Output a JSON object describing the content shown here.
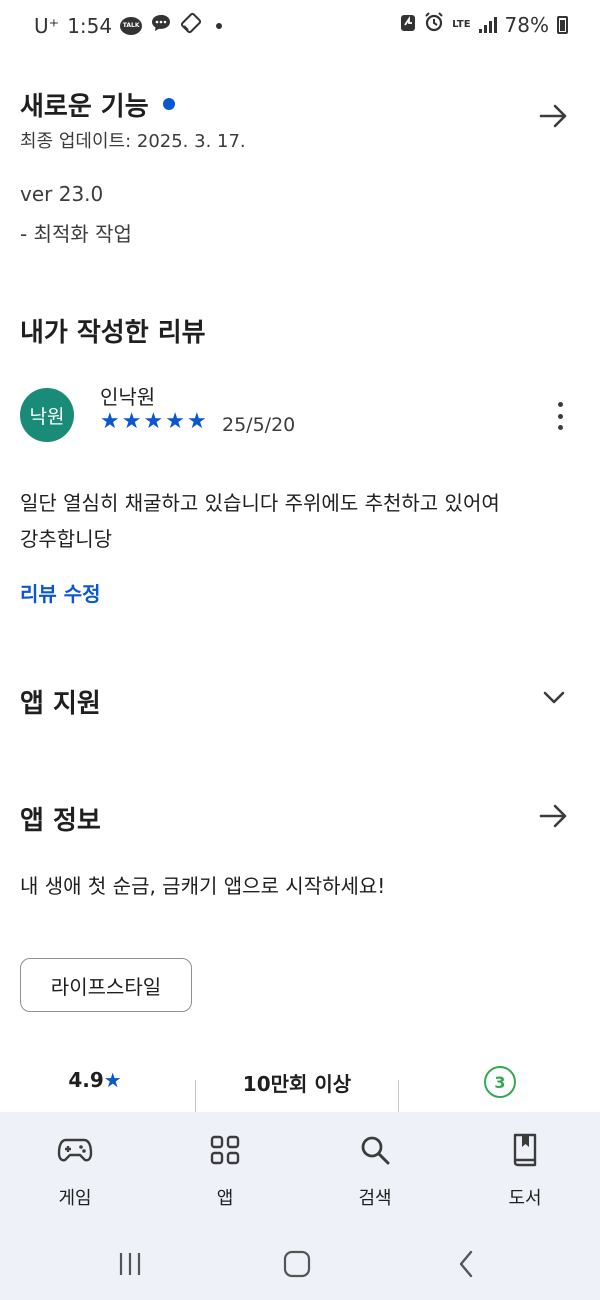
{
  "status_bar": {
    "carrier": "U⁺",
    "time": "1:54",
    "kakaotalk_label": "TALK",
    "network": "LTE",
    "battery": "78%"
  },
  "whats_new": {
    "title": "새로운 기능",
    "updated": "최종 업데이트: 2025. 3. 17.",
    "version": "ver 23.0",
    "note": "- 최적화 작업"
  },
  "my_review": {
    "title": "내가 작성한 리뷰",
    "avatar_text": "낙원",
    "reviewer": "인낙원",
    "rating": 5,
    "stars": [
      "★",
      "★",
      "★",
      "★",
      "★"
    ],
    "date": "25/5/20",
    "body_line1": "일단 열심히 채굴하고 있습니다 주위에도 추천하고 있어여",
    "body_line2": "강추합니당",
    "edit_label": "리뷰 수정"
  },
  "app_support": {
    "title": "앱 지원"
  },
  "app_info": {
    "title": "앱 정보",
    "description": "내 생애 첫 순금, 금캐기 앱으로 시작하세요!",
    "category_chip": "라이프스타일"
  },
  "stats": {
    "rating": "4.9",
    "rating_star": "★",
    "downloads": "10만회 이상",
    "age": "3"
  },
  "bottom_nav": {
    "items": [
      {
        "label": "게임"
      },
      {
        "label": "앱"
      },
      {
        "label": "검색"
      },
      {
        "label": "도서"
      }
    ]
  },
  "colors": {
    "accent": "#0b57d0",
    "avatar": "#1a8a79",
    "age_badge": "#34a853",
    "nav_bg": "#eef2f8"
  }
}
